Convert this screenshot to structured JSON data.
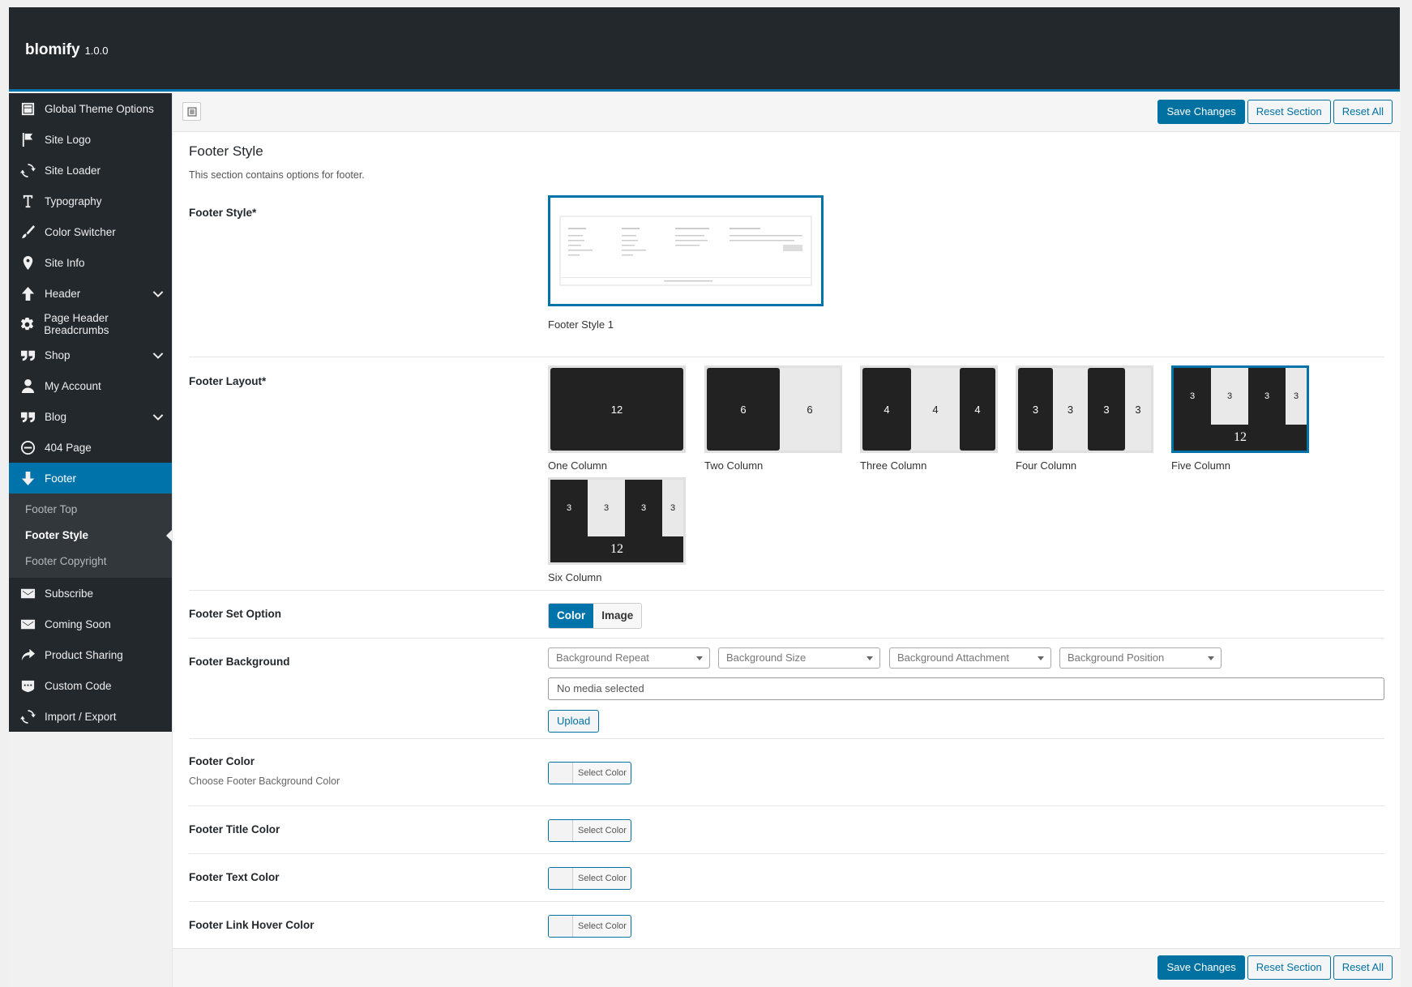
{
  "app": {
    "brand": "blomify",
    "version": "1.0.0"
  },
  "sidebar": {
    "items": [
      {
        "label": "Global Theme Options",
        "icon": "layout-icon"
      },
      {
        "label": "Site Logo",
        "icon": "flag-icon"
      },
      {
        "label": "Site Loader",
        "icon": "refresh-icon"
      },
      {
        "label": "Typography",
        "icon": "text-icon"
      },
      {
        "label": "Color Switcher",
        "icon": "brush-icon"
      },
      {
        "label": "Site Info",
        "icon": "location-icon"
      },
      {
        "label": "Header",
        "icon": "arrow-up-icon",
        "has_children": true
      },
      {
        "label": "Page Header Breadcrumbs",
        "icon": "gear-icon"
      },
      {
        "label": "Shop",
        "icon": "quote-icon",
        "has_children": true
      },
      {
        "label": "My Account",
        "icon": "user-icon"
      },
      {
        "label": "Blog",
        "icon": "quote-icon",
        "has_children": true
      },
      {
        "label": "404 Page",
        "icon": "minus-circle-icon"
      },
      {
        "label": "Footer",
        "icon": "arrow-down-icon",
        "active": true
      }
    ],
    "footer_sub": [
      "Footer Top",
      "Footer Style",
      "Footer Copyright"
    ],
    "items_after": [
      {
        "label": "Subscribe",
        "icon": "envelope-icon"
      },
      {
        "label": "Coming Soon",
        "icon": "envelope-icon"
      },
      {
        "label": "Product Sharing",
        "icon": "share-icon"
      },
      {
        "label": "Custom Code",
        "icon": "css-icon"
      },
      {
        "label": "Import / Export",
        "icon": "refresh-icon"
      }
    ]
  },
  "toolbar": {
    "save": "Save Changes",
    "reset_section": "Reset Section",
    "reset_all": "Reset All"
  },
  "section": {
    "title": "Footer Style",
    "desc": "This section contains options for footer."
  },
  "fields": {
    "footer_style": {
      "label": "Footer Style*",
      "option": "Footer Style 1"
    },
    "footer_layout": {
      "label": "Footer Layout*",
      "options": [
        {
          "caption": "One Column",
          "cols": [
            "12"
          ]
        },
        {
          "caption": "Two Column",
          "cols": [
            "6",
            "6"
          ]
        },
        {
          "caption": "Three Column",
          "cols": [
            "4",
            "4",
            "4"
          ]
        },
        {
          "caption": "Four Column",
          "cols": [
            "3",
            "3",
            "3",
            "3"
          ]
        },
        {
          "caption": "Five Column",
          "cols": [
            "3",
            "3",
            "3",
            "3",
            "12"
          ],
          "selected": true
        },
        {
          "caption": "Six Column",
          "cols": [
            "3",
            "3",
            "3",
            "3",
            "12"
          ]
        }
      ]
    },
    "footer_set_option": {
      "label": "Footer Set Option",
      "on": "Color",
      "off": "Image"
    },
    "footer_background": {
      "label": "Footer Background",
      "selects": [
        "Background Repeat",
        "Background Size",
        "Background Attachment",
        "Background Position"
      ],
      "media": "No media selected",
      "upload": "Upload"
    },
    "footer_color": {
      "label": "Footer Color",
      "sub": "Choose Footer Background Color",
      "btn": "Select Color"
    },
    "footer_title_color": {
      "label": "Footer Title Color",
      "btn": "Select Color"
    },
    "footer_text_color": {
      "label": "Footer Text Color",
      "btn": "Select Color"
    },
    "footer_link_hover_color": {
      "label": "Footer Link Hover Color",
      "btn": "Select Color"
    }
  }
}
